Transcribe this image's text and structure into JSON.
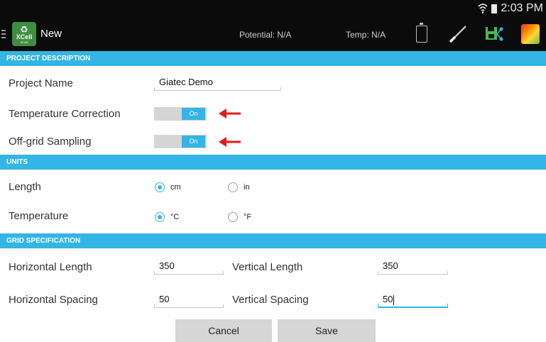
{
  "status_bar": {
    "time": "2:03 PM"
  },
  "action_bar": {
    "app_logo_text": "XCell",
    "app_logo_subtext": "SCAN",
    "title": "New",
    "potential": "Potential: N/A",
    "temp": "Temp: N/A",
    "icons": [
      "menu-icon",
      "battery-icon",
      "probe-icon",
      "save-icon",
      "map-icon"
    ]
  },
  "project_description": {
    "header": "PROJECT DESCRIPTION",
    "project_name_label": "Project Name",
    "project_name_value": "Giatec Demo",
    "temperature_correction_label": "Temperature Correction",
    "temperature_correction_state": "On",
    "off_grid_sampling_label": "Off-grid Sampling",
    "off_grid_sampling_state": "On"
  },
  "units": {
    "header": "UNITS",
    "length_label": "Length",
    "length_options": [
      "cm",
      "in"
    ],
    "length_selected": "cm",
    "temperature_label": "Temperature",
    "temperature_options": [
      "°C",
      "°F"
    ],
    "temperature_selected": "°C"
  },
  "grid_specification": {
    "header": "GRID SPECIFICATION",
    "horizontal_length_label": "Horizontal Length",
    "horizontal_length_value": "350",
    "vertical_length_label": "Vertical Length",
    "vertical_length_value": "350",
    "horizontal_spacing_label": "Horizontal Spacing",
    "horizontal_spacing_value": "50",
    "vertical_spacing_label": "Vertical Spacing",
    "vertical_spacing_value": "50"
  },
  "buttons": {
    "cancel": "Cancel",
    "save": "Save"
  },
  "colors": {
    "accent": "#33b5e5",
    "action_bar": "#0b0b0b",
    "arrow": "#e01b1b",
    "button": "#d6d6d6"
  }
}
